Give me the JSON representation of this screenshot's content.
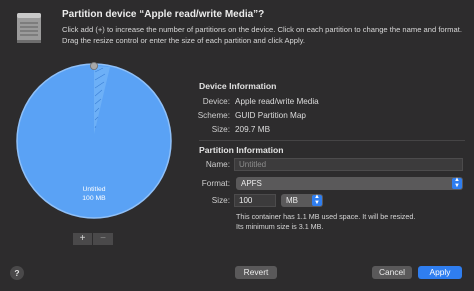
{
  "dialog": {
    "title": "Partition device “Apple read/write Media”?",
    "description": "Click add (+) to increase the number of partitions on the device. Click on each partition to change the name and format. Drag the resize control or enter the size of each partition and click Apply."
  },
  "pie": {
    "partition_name": "Untitled",
    "partition_size": "100 MB",
    "color": "#5aa2f5",
    "add_label": "+",
    "remove_label": "−"
  },
  "device_info": {
    "heading": "Device Information",
    "device_label": "Device:",
    "device_value": "Apple read/write Media",
    "scheme_label": "Scheme:",
    "scheme_value": "GUID Partition Map",
    "size_label": "Size:",
    "size_value": "209.7 MB"
  },
  "partition_info": {
    "heading": "Partition Information",
    "name_label": "Name:",
    "name_placeholder": "Untitled",
    "format_label": "Format:",
    "format_value": "APFS",
    "size_label": "Size:",
    "size_value": "100",
    "unit_value": "MB",
    "note_line1": "This container has 1.1 MB used space. It will be resized.",
    "note_line2": "Its minimum size is 3.1 MB."
  },
  "buttons": {
    "help": "?",
    "revert": "Revert",
    "cancel": "Cancel",
    "apply": "Apply"
  },
  "colors": {
    "accent": "#2f7ef0",
    "background": "#2d2c2d"
  }
}
